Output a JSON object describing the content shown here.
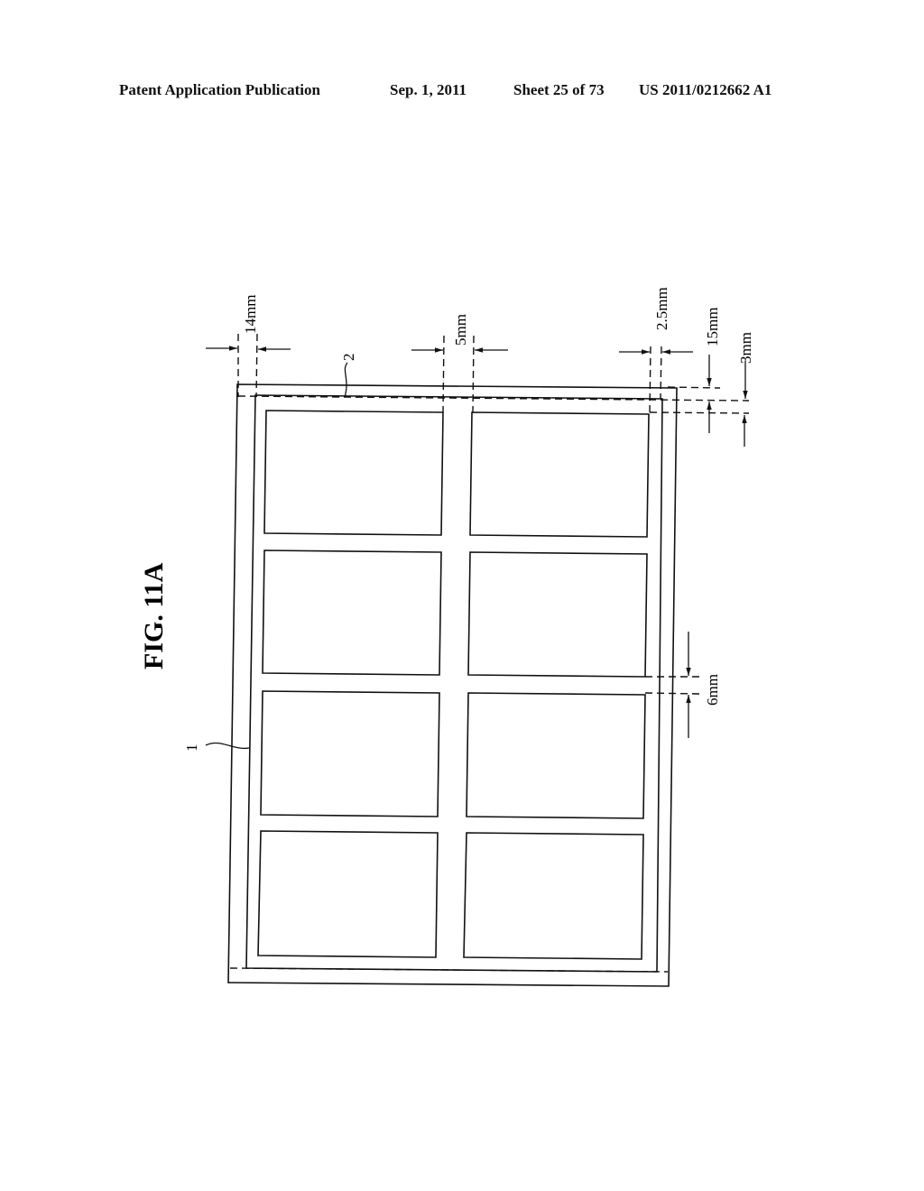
{
  "header": {
    "publication": "Patent Application Publication",
    "date": "Sep. 1, 2011",
    "sheet": "Sheet 25 of 73",
    "number": "US 2011/0212662 A1"
  },
  "figure": {
    "title": "FIG. 11A",
    "reference_labels": {
      "panel": "1",
      "cut_line": "2"
    },
    "dimensions": {
      "left_margin": "14mm",
      "center_gap": "5mm",
      "right_margin": "2.5mm",
      "top_margin": "15mm",
      "top_offset": "3mm",
      "row_gap": "6mm"
    },
    "grid": {
      "rows": 4,
      "columns": 2
    }
  }
}
